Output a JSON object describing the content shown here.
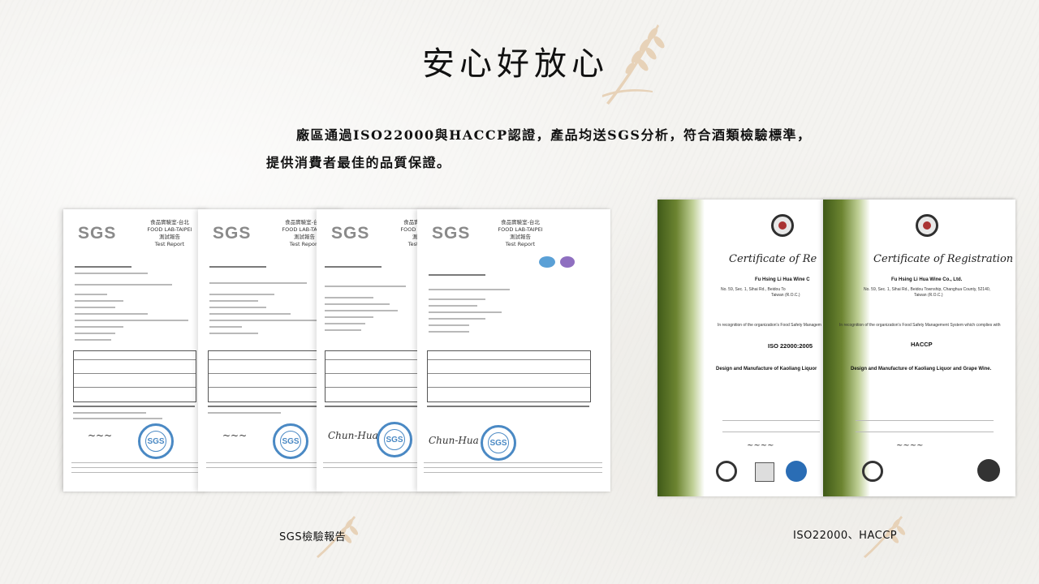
{
  "page": {
    "title": "安心好放心",
    "intro_line1": "廠區通過ISO22000與HACCP認證，產品均送SGS分析，符合酒類檢驗標準，",
    "intro_line2": "提供消費者最佳的品質保證。"
  },
  "reports": {
    "caption": "SGS檢驗報告",
    "logo": "SGS",
    "lab_name_zh": "食品實驗室-台北",
    "lab_name_en": "FOOD LAB-TAIPEI",
    "report_zh": "測試報告",
    "report_en": "Test Report",
    "stamp_text": "SGS",
    "sheets": [
      "sheet-1",
      "sheet-2",
      "sheet-3",
      "sheet-4"
    ]
  },
  "certificates": {
    "caption": "ISO22000、HACCP",
    "items": [
      {
        "title": "Certificate of Re",
        "company": "Fu Hsing Li Hua Wine C",
        "address": "No. 59, Sec. 1, Sihai Rd., Beidou To",
        "country": "Taiwan (R.O.C.)",
        "standard": "ISO 22000:2005",
        "scope": "Design and Manufacture of Kaoliang Liquor",
        "recognition": "In recognition of the organization's Food Safety Managem"
      },
      {
        "title": "Certificate of Registration",
        "company": "Fu Hsing Li Hua Wine Co., Ltd.",
        "address": "No. 59, Sec. 1, Sihai Rd., Beidou Township, Changhua County, 52140,",
        "country": "Taiwan (R.O.C.)",
        "standard": "HACCP",
        "scope": "Design and Manufacture of Kaoliang Liquor and Grape Wine.",
        "recognition": "In recognition of the organization's Food Safety Management System which complies with"
      }
    ]
  },
  "colors": {
    "accent_wheat": "#e7d2b8",
    "stamp_blue": "#4a89c4",
    "cert_green": "#4e6b1f"
  }
}
